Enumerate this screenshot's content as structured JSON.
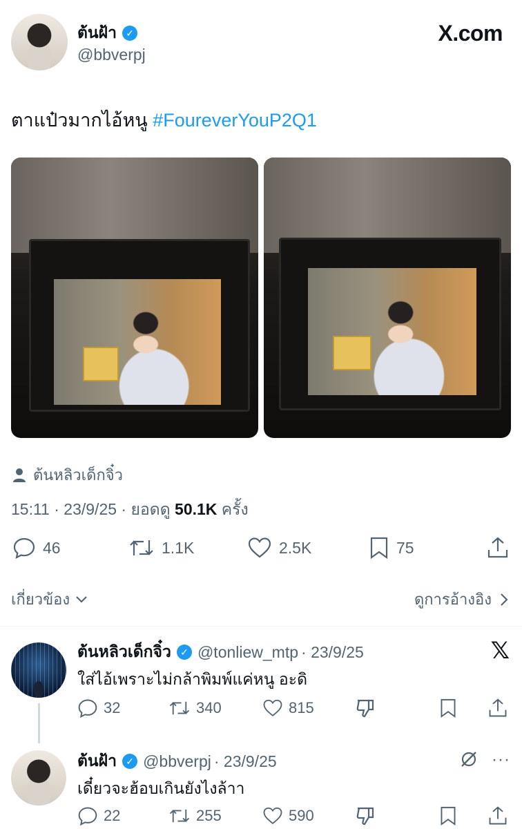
{
  "post": {
    "author_name": "ต้นฝ้า",
    "author_handle": "@bbverpj",
    "brand": "X.com",
    "text": "ตาแป๋วมากไอ้หนู ",
    "hashtag": "#FoureverYouP2Q1",
    "tagged_user": "ต้นหลิวเด็กจิ๋ว",
    "time": "15:11 · 23/9/25 · ยอดดู ",
    "views": "50.1K",
    "views_suffix": " ครั้ง",
    "stats": {
      "replies": "46",
      "reposts": "1.1K",
      "likes": "2.5K",
      "bookmarks": "75"
    },
    "related_label": "เกี่ยวข้อง",
    "quotes_label": "ดูการอ้างอิง"
  },
  "replies": [
    {
      "name": "ต้นหลิวเด็กจิ๋ว",
      "handle": "@tonliew_mtp",
      "date": "· 23/9/25",
      "text": "ใส่ไอ้เพราะไม่กล้าพิมพ์แค่หนู อะดิ",
      "replies": "32",
      "reposts": "340",
      "likes": "815"
    },
    {
      "name": "ต้นฝ้า",
      "handle": "@bbverpj",
      "date": "· 23/9/25",
      "text": "เดี๋ยวจะฮ้อบเกินยังไงล้าา",
      "replies": "22",
      "reposts": "255",
      "likes": "590"
    }
  ],
  "icons": {
    "verified": "verified-badge-icon",
    "x_logo": "x-logo-icon",
    "more": "more-icon",
    "grok": "grok-icon"
  },
  "colors": {
    "accent": "#1d9bf0",
    "text": "#0f1419",
    "muted": "#536471"
  }
}
